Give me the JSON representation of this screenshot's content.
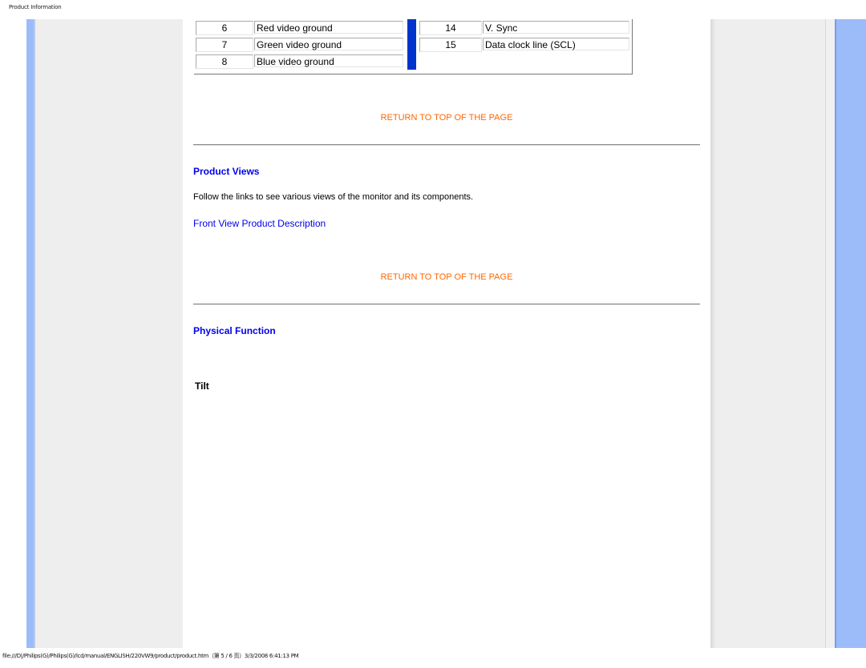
{
  "header": {
    "title": "Product Information"
  },
  "pin_table": {
    "left_rows": [
      {
        "pin": "6",
        "signal": "Red video ground"
      },
      {
        "pin": "7",
        "signal": "Green video ground"
      },
      {
        "pin": "8",
        "signal": "Blue video ground"
      }
    ],
    "right_rows": [
      {
        "pin": "14",
        "signal": "V. Sync"
      },
      {
        "pin": "15",
        "signal": "Data clock line (SCL)"
      }
    ]
  },
  "return_top_label": "RETURN TO TOP OF THE PAGE",
  "product_views": {
    "heading": "Product Views",
    "description": "Follow the links to see various views of the monitor and its components.",
    "link": "Front View Product Description"
  },
  "physical_function": {
    "heading": "Physical Function",
    "tilt_label": "Tilt"
  },
  "footer": {
    "path": "file:///D|/Philips(G)/Philips(G)/lcd/manual/ENGLISH/220VW9/product/product.htm（第 5 / 6 页）3/3/2008 6:41:13 PM"
  },
  "colors": {
    "accent_blue": "#0000ee",
    "return_link_orange": "#ff6600",
    "sidebar_blue": "#9bbcf9",
    "divider_blue": "#0033cc",
    "panel_gray": "#eeeeee"
  }
}
